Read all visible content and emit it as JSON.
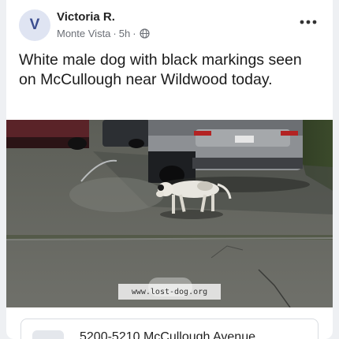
{
  "post": {
    "author": {
      "initial": "V",
      "name": "Victoria R."
    },
    "location": "Monte Vista",
    "separator": "·",
    "time": "5h",
    "separator2": "·",
    "visibility_icon": "globe-icon",
    "more_icon": "more-options-icon",
    "text": "White male dog with black markings seen on McCullough near Wildwood today.",
    "image": {
      "description_icon": "photo",
      "watermark": "www.lost-dog.org"
    },
    "location_card": {
      "address": "5200-5210 McCullough Avenue"
    }
  },
  "colors": {
    "avatar_bg": "#dfe4f2",
    "avatar_text": "#3b4d8f",
    "meta_text": "#6b6f76",
    "card_bg": "#ffffff"
  }
}
